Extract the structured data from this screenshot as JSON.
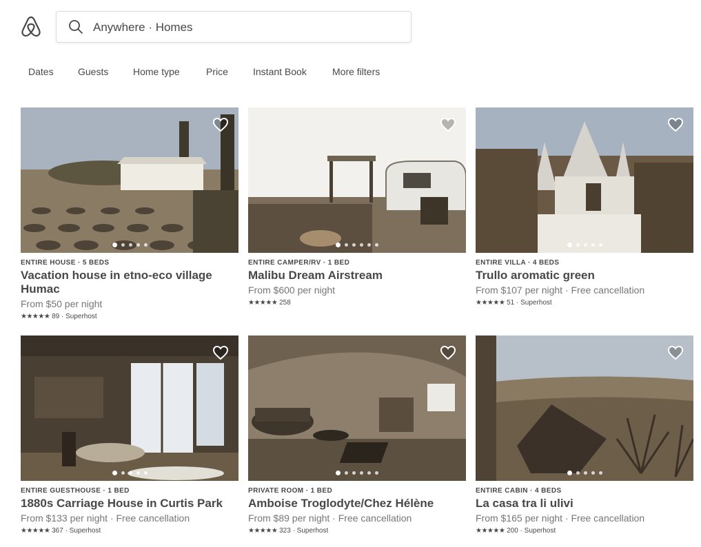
{
  "search": {
    "text": "Anywhere · Homes"
  },
  "filters": [
    "Dates",
    "Guests",
    "Home type",
    "Price",
    "Instant Book",
    "More filters"
  ],
  "listings": [
    {
      "kind": "ENTIRE HOUSE · 5 BEDS",
      "title": "Vacation house in etno-eco village Humac",
      "price": "From $50  per night",
      "stars": "★★★★★",
      "meta": "89 · Superhost",
      "scene": "lavender"
    },
    {
      "kind": "ENTIRE CAMPER/RV · 1 BED",
      "title": "Malibu Dream Airstream",
      "price": "From $600  per night",
      "stars": "★★★★★",
      "meta": "258",
      "scene": "airstream"
    },
    {
      "kind": "ENTIRE VILLA · 4 BEDS",
      "title": "Trullo aromatic green",
      "price": "From $107  per night · Free cancellation",
      "stars": "★★★★★",
      "meta": "51 · Superhost",
      "scene": "trullo"
    },
    {
      "kind": "ENTIRE GUESTHOUSE · 1 BED",
      "title": "1880s Carriage House in Curtis Park",
      "price": "From $133  per night · Free cancellation",
      "stars": "★★★★★",
      "meta": "367 · Superhost",
      "scene": "interior"
    },
    {
      "kind": "PRIVATE ROOM · 1 BED",
      "title": "Amboise Troglodyte/Chez Hélène",
      "price": "From $89  per night · Free cancellation",
      "stars": "★★★★★",
      "meta": "323 · Superhost",
      "scene": "cave"
    },
    {
      "kind": "ENTIRE CABIN · 4 BEDS",
      "title": "La casa tra li ulivi",
      "price": "From $165  per night · Free cancellation",
      "stars": "★★★★★",
      "meta": "200 · Superhost",
      "scene": "valley"
    }
  ],
  "colors": {
    "text": "#484848",
    "muted": "#767676",
    "border": "#dcdcdc"
  },
  "icons": {
    "logo": "airbnb-belo-logo",
    "search": "search-icon",
    "save": "heart-icon"
  }
}
